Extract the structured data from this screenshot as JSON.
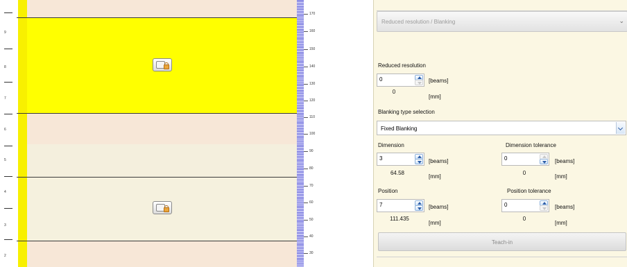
{
  "curtain": {
    "row_numbers": [
      "9",
      "8",
      "7",
      "6",
      "5",
      "4",
      "3",
      "2"
    ],
    "scale_labels": [
      "170",
      "160",
      "150",
      "140",
      "130",
      "120",
      "110",
      "100",
      "90",
      "80",
      "70",
      "60",
      "50",
      "40",
      "30"
    ],
    "zones": [
      {
        "color": "#ffff00",
        "locked": true
      },
      {
        "color": "#f7e7d7",
        "locked": false
      },
      {
        "color": "#f4efdd",
        "locked": false
      },
      {
        "color": "#f5f1de",
        "locked": true
      },
      {
        "color": "#f7e7d7",
        "locked": false
      }
    ],
    "icons": {
      "lock": "lock-icon"
    }
  },
  "panel": {
    "section_title": "Reduced resolution / Blanking",
    "reduced_resolution": {
      "label": "Reduced resolution",
      "value": "0",
      "unit_beams": "[beams]",
      "mm_value": "0",
      "unit_mm": "[mm]"
    },
    "blanking_type": {
      "label": "Blanking type selection",
      "selected": "Fixed Blanking"
    },
    "dimension": {
      "label": "Dimension",
      "value": "3",
      "unit_beams": "[beams]",
      "mm_value": "64.58",
      "unit_mm": "[mm]"
    },
    "dimension_tolerance": {
      "label": "Dimension tolerance",
      "value": "0",
      "unit_beams": "[beams]",
      "mm_value": "0",
      "unit_mm": "[mm]"
    },
    "position": {
      "label": "Position",
      "value": "7",
      "unit_beams": "[beams]",
      "mm_value": "111.435",
      "unit_mm": "[mm]"
    },
    "position_tolerance": {
      "label": "Position tolerance",
      "value": "0",
      "unit_beams": "[beams]",
      "mm_value": "0",
      "unit_mm": "[mm]"
    },
    "teach_in_label": "Teach-in"
  },
  "colors": {
    "strip_yellow": "#f8f000",
    "panel_background": "#fbf7e3",
    "scale_blue": "#5c5cd6"
  }
}
